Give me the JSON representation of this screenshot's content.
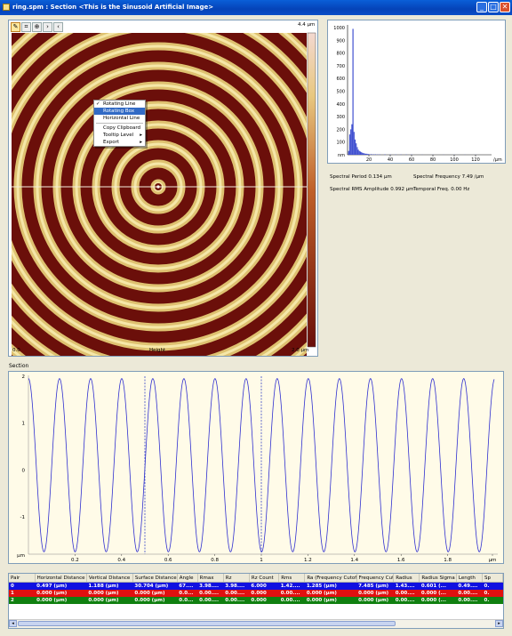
{
  "window": {
    "title": "ring.spm : Section <This is the Sinusoid Artificial Image>",
    "minimize": "_",
    "maximize": "□",
    "close": "✕"
  },
  "image_panel": {
    "tools": [
      "pencil-icon",
      "crop-icon",
      "zoom-icon",
      "next-icon",
      "previous-icon"
    ],
    "scale_max": "4.4 µm",
    "x_min": "0.0",
    "x_label": "Height",
    "x_max": "2.0 µm"
  },
  "context_menu": {
    "items": [
      {
        "label": "Rotating Line",
        "checked": true
      },
      {
        "label": "Rotating Box",
        "selected": true
      },
      {
        "label": "Horizontal Line"
      },
      {
        "label": "Copy Clipboard"
      },
      {
        "label": "Tooltip Level",
        "submenu": true
      },
      {
        "label": "Export",
        "submenu": true
      }
    ]
  },
  "histogram": {
    "type": "bar",
    "y_ticks": [
      "1000",
      "900",
      "800",
      "700",
      "600",
      "500",
      "400",
      "300",
      "200",
      "100",
      "nm"
    ],
    "x_ticks": [
      "20",
      "40",
      "60",
      "80",
      "100",
      "120"
    ],
    "x_unit": "/µm",
    "ylim": [
      0,
      1000
    ],
    "xlim": [
      0,
      135
    ]
  },
  "spectral": {
    "period": "Spectral Period 0.134 µm",
    "frequency": "Spectral Frequency 7.49 /µm",
    "rms_amplitude": "Spectral RMS Amplitude 0.992 µm",
    "temporal_freq": "Temporal Freq. 0.00 Hz"
  },
  "section": {
    "label": "Section",
    "y_ticks": [
      "2",
      "1",
      "0",
      "-1",
      "µm"
    ],
    "x_ticks": [
      "0.2",
      "0.4",
      "0.6",
      "0.8",
      "1",
      "1.2",
      "1.4",
      "1.6",
      "1.8",
      "µm"
    ]
  },
  "chart_data": [
    {
      "type": "bar",
      "title": "",
      "x_unit": "/µm",
      "series": [
        {
          "x": [
            1,
            2,
            3,
            4,
            5,
            6,
            7,
            8,
            9,
            10,
            11,
            12,
            13,
            14,
            15,
            16,
            17,
            18,
            19,
            20,
            22,
            24,
            26,
            28,
            30,
            35,
            40,
            45,
            50,
            55,
            60,
            70,
            80,
            90,
            100,
            110,
            120
          ],
          "values": [
            30,
            160,
            200,
            240,
            990,
            180,
            120,
            90,
            60,
            40,
            30,
            25,
            20,
            15,
            12,
            10,
            8,
            8,
            6,
            5,
            5,
            4,
            4,
            3,
            3,
            3,
            2,
            2,
            2,
            2,
            2,
            1,
            1,
            1,
            1,
            1,
            1
          ]
        }
      ]
    },
    {
      "type": "line",
      "title": "",
      "xlim": [
        0,
        2.0
      ],
      "ylim": [
        -1.8,
        2.0
      ],
      "cursor_positions": [
        0.5,
        1.0
      ],
      "series": [
        {
          "frequency_per_um": 7.49,
          "amplitude": 1.85,
          "offset": 0.1
        }
      ]
    }
  ],
  "results_table": {
    "headers": [
      "Pair",
      "Horizontal Distance",
      "Vertical Distance",
      "Surface Distance",
      "Angle",
      "Rmax",
      "Rz",
      "Rz Count",
      "Rms",
      "Ra (Frequency Cutoff)",
      "Frequency Cutoff",
      "Radius",
      "Radius Sigma",
      "Length",
      "Sp"
    ],
    "rows": [
      {
        "color": "#1010e0",
        "cells": [
          "0",
          "0.497 (µm)",
          "1.188 (µm)",
          "30.704 (µm)",
          "67....",
          "3.98....",
          "3.98....",
          "6.000",
          "1.42....",
          "1.285 (µm)",
          "7.485 (µm)",
          "1.43....",
          "0.601 (...",
          "0.49....",
          "0."
        ]
      },
      {
        "color": "#e01010",
        "cells": [
          "1",
          "0.000 (µm)",
          "0.000 (µm)",
          "0.000 (µm)",
          "0.0...",
          "0.00....",
          "0.00....",
          "0.000",
          "0.00....",
          "0.000 (µm)",
          "0.000 (µm)",
          "0.00....",
          "0.000 (...",
          "0.00....",
          "0."
        ]
      },
      {
        "color": "#108010",
        "cells": [
          "2",
          "0.000 (µm)",
          "0.000 (µm)",
          "0.000 (µm)",
          "0.0...",
          "0.00....",
          "0.00....",
          "0.000",
          "0.00....",
          "0.000 (µm)",
          "0.000 (µm)",
          "0.00....",
          "0.000 (...",
          "0.00....",
          "0."
        ]
      }
    ]
  },
  "colors": {
    "ring_dark": "#6b0f0a",
    "ring_light": "#e8d07a",
    "curve": "#3030d0",
    "hist_bar": "#4050d0"
  }
}
